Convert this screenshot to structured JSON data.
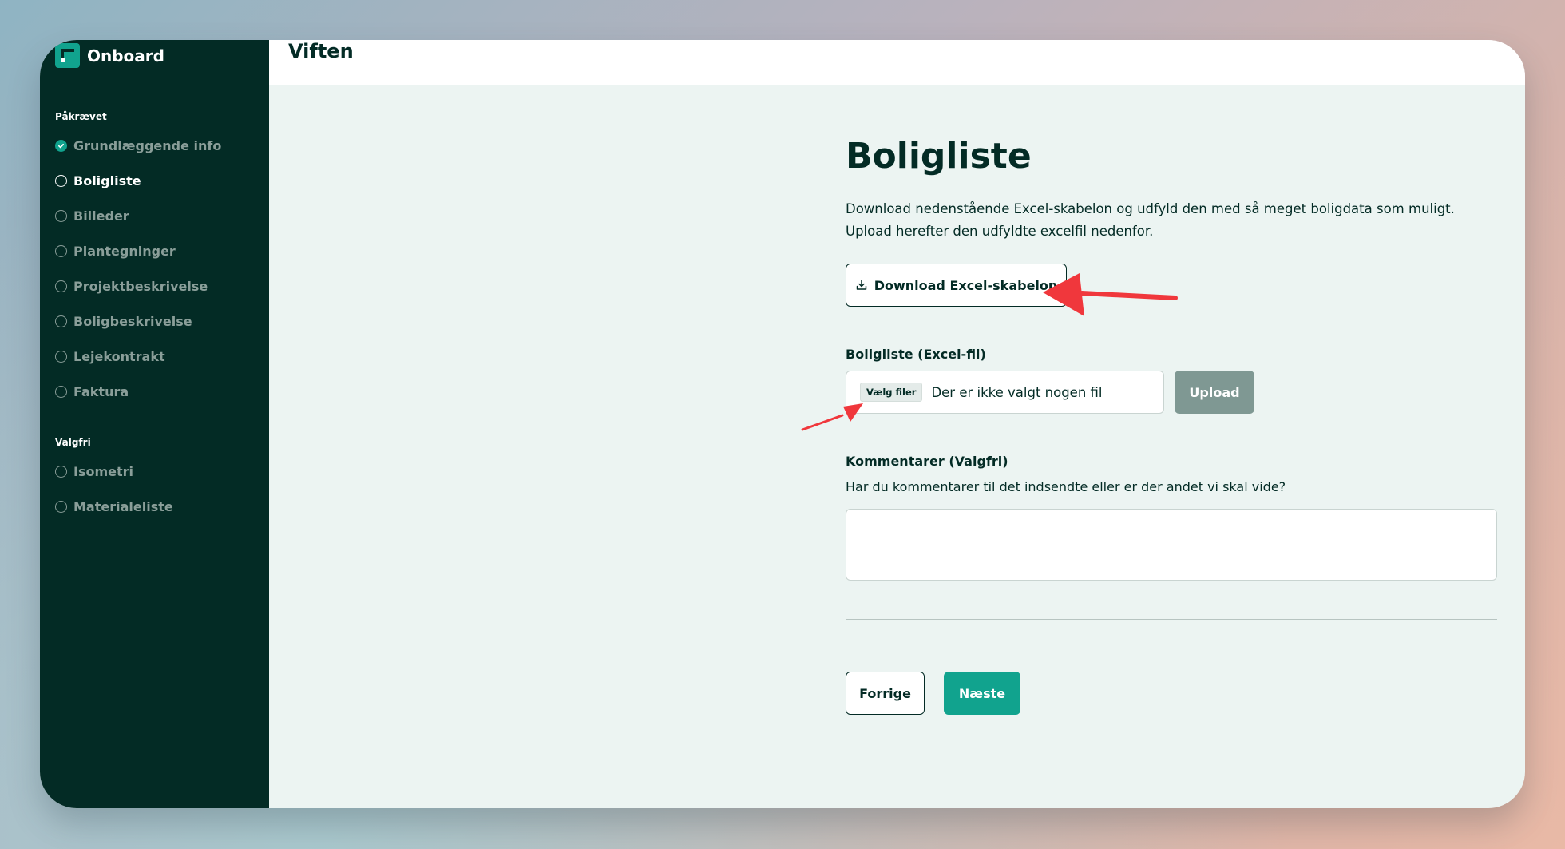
{
  "brand": {
    "name": "Onboard"
  },
  "sidebar": {
    "required_label": "Påkrævet",
    "required_items": [
      {
        "label": "Grundlæggende info",
        "status": "done"
      },
      {
        "label": "Boligliste",
        "status": "active"
      },
      {
        "label": "Billeder",
        "status": "pending"
      },
      {
        "label": "Plantegninger",
        "status": "pending"
      },
      {
        "label": "Projektbeskrivelse",
        "status": "pending"
      },
      {
        "label": "Boligbeskrivelse",
        "status": "pending"
      },
      {
        "label": "Lejekontrakt",
        "status": "pending"
      },
      {
        "label": "Faktura",
        "status": "pending"
      }
    ],
    "optional_label": "Valgfri",
    "optional_items": [
      {
        "label": "Isometri",
        "status": "pending"
      },
      {
        "label": "Materialeliste",
        "status": "pending"
      }
    ]
  },
  "topbar": {
    "title": "Viften"
  },
  "main": {
    "title": "Boligliste",
    "intro": "Download nedenstående Excel-skabelon og udfyld den med så meget boligdata som muligt. Upload herefter den udfyldte excelfil nedenfor.",
    "download_button": "Download Excel-skabelon",
    "file_field_label": "Boligliste (Excel-fil)",
    "file_choose_label": "Vælg filer",
    "file_status": "Der er ikke valgt nogen fil",
    "upload_button": "Upload",
    "comments_label": "Kommentarer (Valgfri)",
    "comments_help": "Har du kommentarer til det indsendte eller er der andet vi skal vide?",
    "comments_value": "",
    "prev_button": "Forrige",
    "next_button": "Næste"
  },
  "colors": {
    "sidebar_bg": "#032b25",
    "accent": "#11a38e",
    "content_bg": "#ecf4f2",
    "upload_disabled": "#7f9893",
    "annotation_arrow": "#f0373c"
  }
}
